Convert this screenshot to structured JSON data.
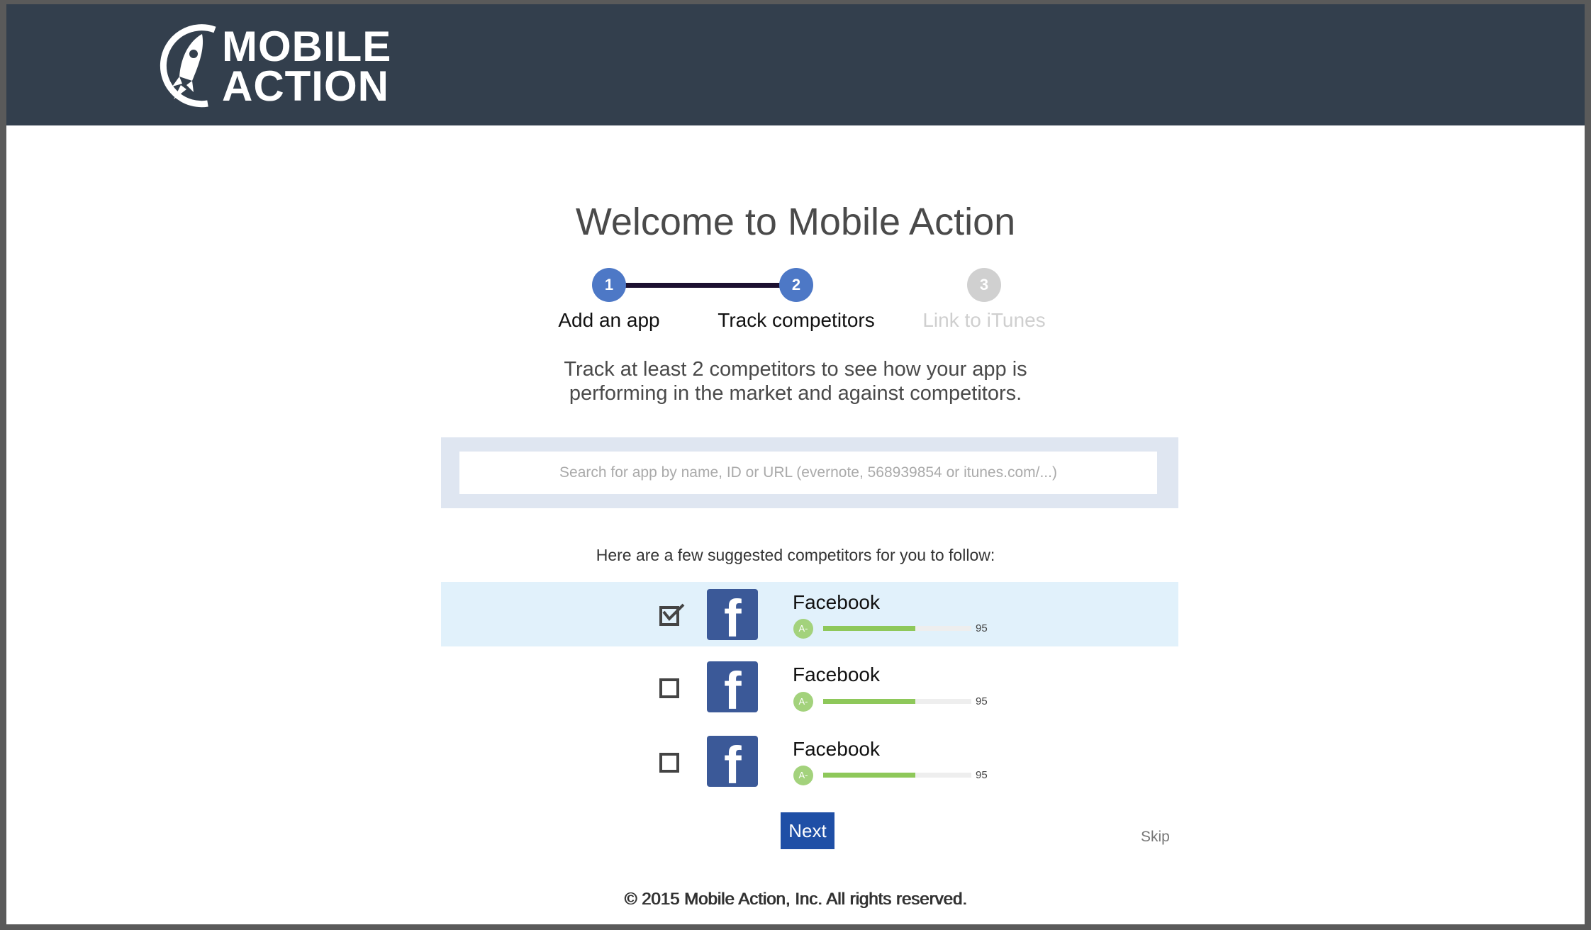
{
  "header": {
    "logo_line1": "MOBILE",
    "logo_line2": "ACTION"
  },
  "main": {
    "title": "Welcome to Mobile Action",
    "steps": [
      {
        "number": "1",
        "label": "Add an app",
        "state": "complete"
      },
      {
        "number": "2",
        "label": "Track competitors",
        "state": "active"
      },
      {
        "number": "3",
        "label": "Link to iTunes",
        "state": "inactive"
      }
    ],
    "intro_line1": "Track at least 2 competitors to see how your app is",
    "intro_line2": "performing in the market and against competitors.",
    "search": {
      "placeholder": "Search for app by name, ID or URL (evernote, 568939854 or itunes.com/...)",
      "value": ""
    },
    "suggest_label": "Here are a few suggested competitors for you to follow:",
    "competitors": [
      {
        "name": "Facebook",
        "grade": "A-",
        "score": "95",
        "score_fraction": 0.62,
        "checked": true,
        "icon": "facebook-icon"
      },
      {
        "name": "Facebook",
        "grade": "A-",
        "score": "95",
        "score_fraction": 0.62,
        "checked": false,
        "icon": "facebook-icon"
      },
      {
        "name": "Facebook",
        "grade": "A-",
        "score": "95",
        "score_fraction": 0.62,
        "checked": false,
        "icon": "facebook-icon"
      }
    ],
    "next_label": "Next",
    "skip_label": "Skip"
  },
  "footer": {
    "copyright": "© 2015 Mobile Action, Inc. All rights reserved."
  },
  "colors": {
    "header_bg": "#333f4d",
    "step_active": "#4d78c6",
    "step_inactive": "#d0d0d0",
    "selected_row_bg": "#e1f1fb",
    "search_wrap_bg": "#dfe6f1",
    "next_button_bg": "#1f4fa6",
    "grade_badge": "#a3d27c",
    "score_bar_fill": "#8ec85a",
    "facebook_blue": "#3b5998"
  }
}
